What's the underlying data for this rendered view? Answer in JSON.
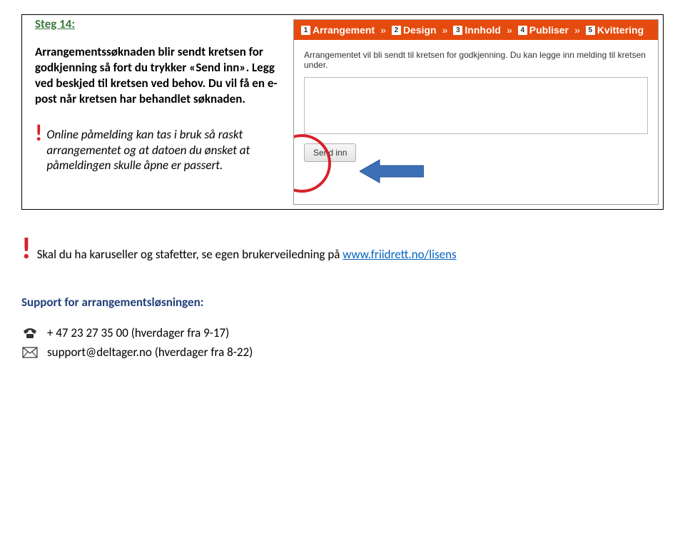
{
  "step": {
    "label": "Steg 14:",
    "body": "Arrangementssøknaden blir sendt kretsen for godkjenning så fort du trykker «Send inn». Legg ved beskjed til kretsen ved behov. Du vil få en e-post når kretsen har behandlet søknaden.",
    "note": "Online påmelding kan tas i bruk så raskt arrangementet og at datoen du ønsket at påmeldingen skulle åpne er passert."
  },
  "screenshot": {
    "breadcrumb": [
      {
        "num": "1",
        "label": "Arrangement"
      },
      {
        "num": "2",
        "label": "Design"
      },
      {
        "num": "3",
        "label": "Innhold"
      },
      {
        "num": "4",
        "label": "Publiser"
      },
      {
        "num": "5",
        "label": "Kvittering"
      }
    ],
    "description": "Arrangementet vil bli sendt til kretsen for godkjenning. Du kan legge inn melding til kretsen under.",
    "button": "Send inn"
  },
  "bottom_note": {
    "text": "Skal du ha karuseller og stafetter, se egen brukerveiledning på ",
    "link_text": "www.friidrett.no/lisens"
  },
  "support": {
    "heading": "Support for arrangementsløsningen:",
    "phone": "+ 47 23 27 35 00  (hverdager fra 9-17)",
    "email": "support@deltager.no  (hverdager fra 8-22)"
  }
}
